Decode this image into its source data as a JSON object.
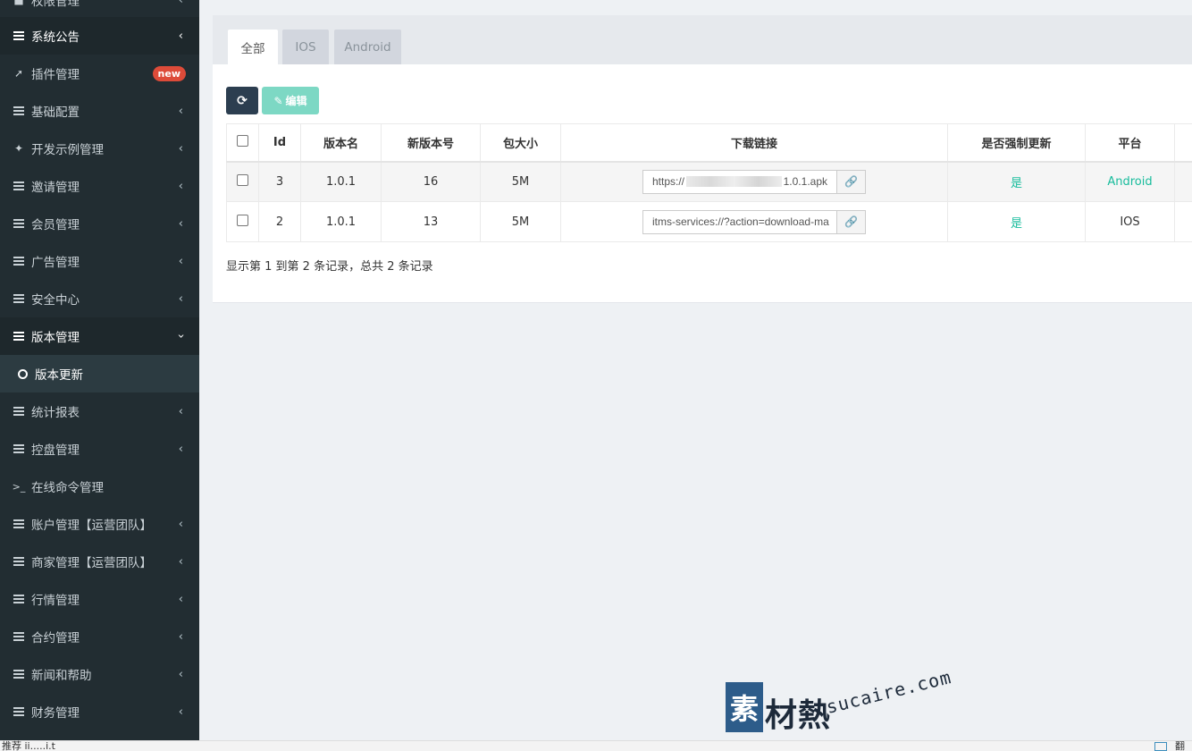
{
  "sidebar": {
    "items": [
      {
        "label": "权限管理",
        "icon": "user-icon"
      },
      {
        "label": "系统公告",
        "icon": "list-icon"
      },
      {
        "label": "插件管理",
        "icon": "rocket-icon",
        "badge": "new"
      },
      {
        "label": "基础配置",
        "icon": "list-icon"
      },
      {
        "label": "开发示例管理",
        "icon": "magic-icon"
      },
      {
        "label": "邀请管理",
        "icon": "list-icon"
      },
      {
        "label": "会员管理",
        "icon": "list-icon"
      },
      {
        "label": "广告管理",
        "icon": "list-icon"
      },
      {
        "label": "安全中心",
        "icon": "list-icon"
      },
      {
        "label": "版本管理",
        "icon": "list-icon"
      },
      {
        "label": "版本更新",
        "icon": "circle-icon"
      },
      {
        "label": "统计报表",
        "icon": "list-icon"
      },
      {
        "label": "控盘管理",
        "icon": "list-icon"
      },
      {
        "label": "在线命令管理",
        "icon": "terminal-icon"
      },
      {
        "label": "账户管理【运营团队】",
        "icon": "list-icon"
      },
      {
        "label": "商家管理【运营团队】",
        "icon": "list-icon"
      },
      {
        "label": "行情管理",
        "icon": "list-icon"
      },
      {
        "label": "合约管理",
        "icon": "list-icon"
      },
      {
        "label": "新闻和帮助",
        "icon": "list-icon"
      },
      {
        "label": "财务管理",
        "icon": "list-icon"
      }
    ]
  },
  "tabs": [
    {
      "label": "全部",
      "active": true
    },
    {
      "label": "IOS",
      "active": false
    },
    {
      "label": "Android",
      "active": false
    }
  ],
  "toolbar": {
    "refresh_icon": "refresh-icon",
    "edit_label": "编辑"
  },
  "table": {
    "columns": [
      "Id",
      "版本名",
      "新版本号",
      "包大小",
      "下载链接",
      "是否强制更新",
      "平台"
    ],
    "rows": [
      {
        "id": "3",
        "name": "1.0.1",
        "version": "16",
        "size": "5M",
        "url_start": "https://",
        "url_end": "1.0.1.apk",
        "force": "是",
        "platform": "Android"
      },
      {
        "id": "2",
        "name": "1.0.1",
        "version": "13",
        "size": "5M",
        "url_start": "itms-services://?action=download-ma",
        "url_end": "",
        "force": "是",
        "platform": "IOS"
      }
    ]
  },
  "summary": "显示第 1 到第 2 条记录，总共 2 条记录",
  "watermark": {
    "box": "素",
    "cn": "材熱",
    "en": "sucaire.com"
  },
  "status_bar": {
    "left": "推荐 ii.....i.t",
    "right": "翻"
  },
  "colors": {
    "sidebar_bg": "#222d32",
    "accent_green": "#18bc9c",
    "badge_red": "#dd4b39",
    "refresh_btn": "#2c3e50",
    "edit_btn": "#7dd8c4"
  }
}
